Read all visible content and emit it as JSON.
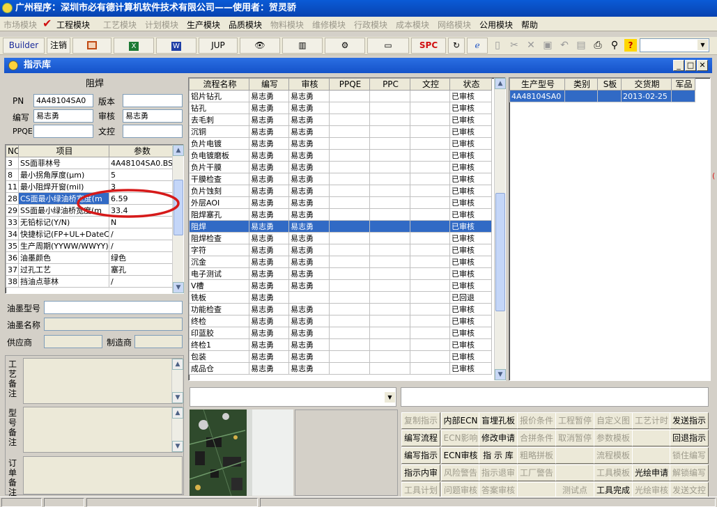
{
  "app_title": "广州程序：深圳市必有德计算机软件技术有限公司——使用者：贺灵骄",
  "menu": [
    {
      "label": "市场模块",
      "enabled": false
    },
    {
      "label": "工程模块",
      "enabled": true
    },
    {
      "label": "工艺模块",
      "enabled": false
    },
    {
      "label": "计划模块",
      "enabled": false
    },
    {
      "label": "生产模块",
      "enabled": true
    },
    {
      "label": "品质模块",
      "enabled": true
    },
    {
      "label": "物料模块",
      "enabled": false
    },
    {
      "label": "维修模块",
      "enabled": false
    },
    {
      "label": "行政模块",
      "enabled": false
    },
    {
      "label": "成本模块",
      "enabled": false
    },
    {
      "label": "网络模块",
      "enabled": false
    },
    {
      "label": "公用模块",
      "enabled": true
    },
    {
      "label": "帮助",
      "enabled": true
    }
  ],
  "toolbar": {
    "builder": "Builder",
    "logout": "注销",
    "jup": "JUP",
    "spc": "SPC"
  },
  "window_title": "指示库",
  "left": {
    "section_title": "阻焊",
    "pn_label": "PN",
    "pn_value": "4A48104SA0",
    "version_label": "版本",
    "version_value": "",
    "writer_label": "编写",
    "writer_value": "易志勇",
    "reviewer_label": "审核",
    "reviewer_value": "易志勇",
    "ppqe_label": "PPQE",
    "ppqe_value": "",
    "doc_label": "文控",
    "doc_value": "",
    "param_headers": [
      "NO",
      "项目",
      "参数"
    ],
    "params": [
      [
        "3",
        "SS面菲林号",
        "4A48104SA0.BS"
      ],
      [
        "8",
        "最小拐角厚度(μm)",
        "5"
      ],
      [
        "11",
        "最小阻焊开窗(mil)",
        "3"
      ],
      [
        "28",
        "CS面最小绿油桥宽度(m",
        "6.59"
      ],
      [
        "29",
        "SS面最小绿油桥宽度(m",
        "33.4"
      ],
      [
        "33",
        "无铅标记(Y/N)",
        "N"
      ],
      [
        "34",
        "快捷标记(FP+UL+DateCo",
        "/"
      ],
      [
        "35",
        "生产周期(YYWW/WWYY)",
        "/"
      ],
      [
        "36",
        "油墨颜色",
        "绿色"
      ],
      [
        "37",
        "过孔工艺",
        "塞孔"
      ],
      [
        "38",
        "挡油点菲林",
        "/"
      ]
    ],
    "selected_param_row": 3,
    "ink_model_label": "油墨型号",
    "ink_model_value": "",
    "ink_name_label": "油墨名称",
    "ink_name_value": "",
    "supplier_label": "供应商",
    "supplier_value": "",
    "maker_label": "制造商",
    "maker_value": "",
    "craft_note_label": "工艺备注",
    "model_note_label": "型号备注",
    "order_note_label": "订单备注"
  },
  "process": {
    "headers": [
      "流程名称",
      "编写",
      "审核",
      "PPQE",
      "PPC",
      "文控",
      "状态"
    ],
    "rows": [
      [
        "铝片钻孔",
        "易志勇",
        "易志勇",
        "",
        "",
        "",
        "已审核"
      ],
      [
        "钻孔",
        "易志勇",
        "易志勇",
        "",
        "",
        "",
        "已审核"
      ],
      [
        "去毛刺",
        "易志勇",
        "易志勇",
        "",
        "",
        "",
        "已审核"
      ],
      [
        "沉铜",
        "易志勇",
        "易志勇",
        "",
        "",
        "",
        "已审核"
      ],
      [
        "负片电镀",
        "易志勇",
        "易志勇",
        "",
        "",
        "",
        "已审核"
      ],
      [
        "负电镀磨板",
        "易志勇",
        "易志勇",
        "",
        "",
        "",
        "已审核"
      ],
      [
        "负片干膜",
        "易志勇",
        "易志勇",
        "",
        "",
        "",
        "已审核"
      ],
      [
        "干膜检查",
        "易志勇",
        "易志勇",
        "",
        "",
        "",
        "已审核"
      ],
      [
        "负片蚀刻",
        "易志勇",
        "易志勇",
        "",
        "",
        "",
        "已审核"
      ],
      [
        "外层AOI",
        "易志勇",
        "易志勇",
        "",
        "",
        "",
        "已审核"
      ],
      [
        "阻焊塞孔",
        "易志勇",
        "易志勇",
        "",
        "",
        "",
        "已审核"
      ],
      [
        "阻焊",
        "易志勇",
        "易志勇",
        "",
        "",
        "",
        "已审核"
      ],
      [
        "阻焊检查",
        "易志勇",
        "易志勇",
        "",
        "",
        "",
        "已审核"
      ],
      [
        "字符",
        "易志勇",
        "易志勇",
        "",
        "",
        "",
        "已审核"
      ],
      [
        "沉金",
        "易志勇",
        "易志勇",
        "",
        "",
        "",
        "已审核"
      ],
      [
        "电子测试",
        "易志勇",
        "易志勇",
        "",
        "",
        "",
        "已审核"
      ],
      [
        "V槽",
        "易志勇",
        "易志勇",
        "",
        "",
        "",
        "已审核"
      ],
      [
        "铣板",
        "易志勇",
        "",
        "",
        "",
        "",
        "已回退"
      ],
      [
        "功能检查",
        "易志勇",
        "易志勇",
        "",
        "",
        "",
        "已审核"
      ],
      [
        "终检",
        "易志勇",
        "易志勇",
        "",
        "",
        "",
        "已审核"
      ],
      [
        "印蓝胶",
        "易志勇",
        "易志勇",
        "",
        "",
        "",
        "已审核"
      ],
      [
        "终检1",
        "易志勇",
        "易志勇",
        "",
        "",
        "",
        "已审核"
      ],
      [
        "包装",
        "易志勇",
        "易志勇",
        "",
        "",
        "",
        "已审核"
      ],
      [
        "成品仓",
        "易志勇",
        "易志勇",
        "",
        "",
        "",
        "已审核"
      ]
    ],
    "selected_row": 11
  },
  "orders": {
    "headers": [
      "生产型号",
      "类别",
      "S板",
      "交货期",
      "军品"
    ],
    "rows": [
      [
        "4A48104SA0",
        "",
        "",
        "2013-02-25",
        ""
      ]
    ]
  },
  "buttons": [
    {
      "label": "复制指示",
      "enabled": false
    },
    {
      "label": "内部ECN",
      "enabled": true
    },
    {
      "label": "盲埋孔板",
      "enabled": true
    },
    {
      "label": "报价条件",
      "enabled": false
    },
    {
      "label": "工程暂停",
      "enabled": false
    },
    {
      "label": "自定义图",
      "enabled": false
    },
    {
      "label": "工艺计时",
      "enabled": false
    },
    {
      "label": "发送指示",
      "enabled": true
    },
    {
      "label": "编写流程",
      "enabled": true
    },
    {
      "label": "ECN影响",
      "enabled": false
    },
    {
      "label": "修改申请",
      "enabled": true
    },
    {
      "label": "合拼条件",
      "enabled": false
    },
    {
      "label": "取消暂停",
      "enabled": false
    },
    {
      "label": "参数模板",
      "enabled": false
    },
    {
      "label": "",
      "enabled": false
    },
    {
      "label": "回退指示",
      "enabled": true
    },
    {
      "label": "编写指示",
      "enabled": true
    },
    {
      "label": "ECN审核",
      "enabled": true
    },
    {
      "label": "指 示 库",
      "enabled": true
    },
    {
      "label": "粗略拼板",
      "enabled": false
    },
    {
      "label": "",
      "enabled": false
    },
    {
      "label": "流程模板",
      "enabled": false
    },
    {
      "label": "",
      "enabled": false
    },
    {
      "label": "锁住编写",
      "enabled": false
    },
    {
      "label": "指示内审",
      "enabled": true
    },
    {
      "label": "风险警告",
      "enabled": false
    },
    {
      "label": "指示退审",
      "enabled": false
    },
    {
      "label": "工厂警告",
      "enabled": false
    },
    {
      "label": "",
      "enabled": false
    },
    {
      "label": "工具模板",
      "enabled": false
    },
    {
      "label": "光绘申请",
      "enabled": true
    },
    {
      "label": "解锁编写",
      "enabled": false
    },
    {
      "label": "工具计划",
      "enabled": false
    },
    {
      "label": "问题审核",
      "enabled": false
    },
    {
      "label": "答案审核",
      "enabled": false
    },
    {
      "label": "",
      "enabled": false
    },
    {
      "label": "测试点",
      "enabled": false
    },
    {
      "label": "工具完成",
      "enabled": true
    },
    {
      "label": "光绘审核",
      "enabled": false
    },
    {
      "label": "发送文控",
      "enabled": false
    }
  ],
  "colors": {
    "selection": "#316ac5",
    "title_blue": "#0a5bd6",
    "annotation_red": "#d61a1a"
  }
}
